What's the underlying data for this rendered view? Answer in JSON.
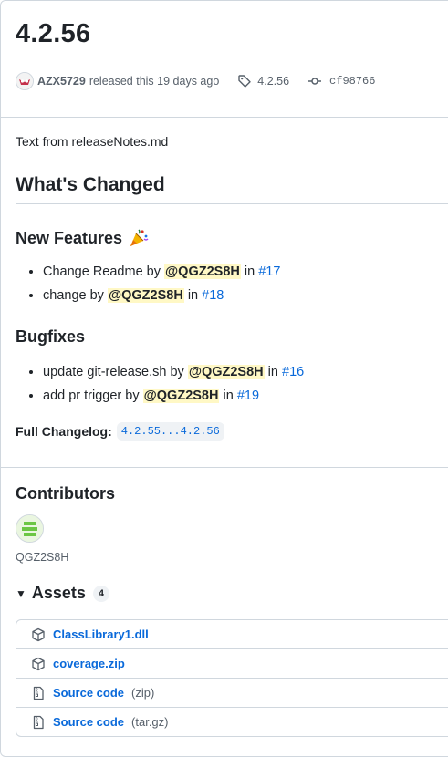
{
  "release": {
    "title": "4.2.56",
    "author": "AZX5729",
    "released_text": "released this 19 days ago",
    "tag": "4.2.56",
    "commit": "cf98766"
  },
  "notes": {
    "intro": "Text from releaseNotes.md",
    "whats_changed": "What's Changed",
    "new_features": "New Features",
    "features": [
      {
        "text": "Change Readme",
        "by": "by",
        "user": "@QGZ2S8H",
        "in": "in",
        "pr": "#17"
      },
      {
        "text": "change",
        "by": "by",
        "user": "@QGZ2S8H",
        "in": "in",
        "pr": "#18"
      }
    ],
    "bugfixes_title": "Bugfixes",
    "bugfixes": [
      {
        "text": "update git-release.sh",
        "by": "by",
        "user": "@QGZ2S8H",
        "in": "in",
        "pr": "#16"
      },
      {
        "text": "add pr trigger",
        "by": "by",
        "user": "@QGZ2S8H",
        "in": "in",
        "pr": "#19"
      }
    ],
    "full_changelog_label": "Full Changelog:",
    "full_changelog_range": "4.2.55...4.2.56"
  },
  "contributors": {
    "title": "Contributors",
    "items": [
      {
        "name": "QGZ2S8H"
      }
    ]
  },
  "assets": {
    "title": "Assets",
    "count": "4",
    "items": [
      {
        "name": "ClassLibrary1.dll",
        "ext": "",
        "icon": "package-icon"
      },
      {
        "name": "coverage.zip",
        "ext": "",
        "icon": "package-icon"
      },
      {
        "name": "Source code",
        "ext": "(zip)",
        "icon": "file-zip-icon"
      },
      {
        "name": "Source code",
        "ext": "(tar.gz)",
        "icon": "file-zip-icon"
      }
    ]
  },
  "colors": {
    "link": "#0969da",
    "mention_bg": "#fff8c5",
    "border": "#d0d7de",
    "muted": "#57606a"
  }
}
